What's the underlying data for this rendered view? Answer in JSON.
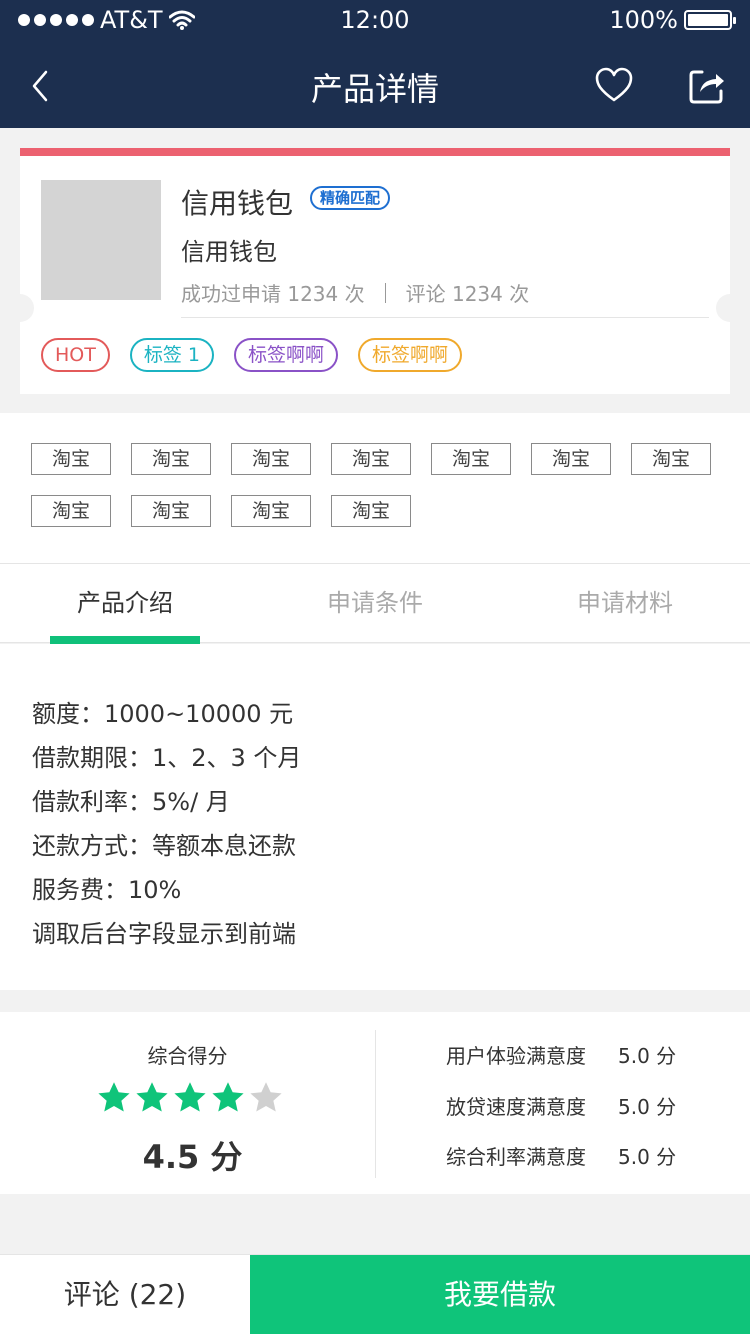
{
  "status_bar": {
    "carrier": "AT&T",
    "time": "12:00",
    "battery": "100%"
  },
  "nav": {
    "title": "产品详情",
    "icons": [
      "chevron-left-icon",
      "heart-icon",
      "share-icon"
    ]
  },
  "product": {
    "name": "信用钱包",
    "badge": "精确匹配",
    "subtitle": "信用钱包",
    "stats": {
      "applied": "成功过申请 1234 次",
      "reviews": "评论 1234 次"
    },
    "tags": [
      "HOT",
      "标签 1",
      "标签啊啊",
      "标签啊啊"
    ]
  },
  "keywords": [
    "淘宝",
    "淘宝",
    "淘宝",
    "淘宝",
    "淘宝",
    "淘宝",
    "淘宝",
    "淘宝",
    "淘宝",
    "淘宝",
    "淘宝"
  ],
  "tabs": [
    {
      "label": "产品介绍",
      "active": true
    },
    {
      "label": "申请条件",
      "active": false
    },
    {
      "label": "申请材料",
      "active": false
    }
  ],
  "intro": [
    "额度：1000~10000 元",
    "借款期限：1、2、3 个月",
    "借款利率：5%/ 月",
    "还款方式：等额本息还款",
    "服务费：10%",
    "调取后台字段显示到前端"
  ],
  "score": {
    "title": "综合得分",
    "stars": 4,
    "max_stars": 5,
    "value": "4.5 分",
    "metrics": [
      {
        "label": "用户体验满意度",
        "value": "5.0 分"
      },
      {
        "label": "放贷速度满意度",
        "value": "5.0 分"
      },
      {
        "label": "综合利率满意度",
        "value": "5.0 分"
      }
    ]
  },
  "bottom_bar": {
    "comment_label": "评论 (22)",
    "borrow_label": "我要借款"
  },
  "colors": {
    "nav_bg": "#1c2f4f",
    "accent_green": "#0fc47a",
    "card_top": "#ec6170",
    "star_gray": "#d0d0d0"
  }
}
